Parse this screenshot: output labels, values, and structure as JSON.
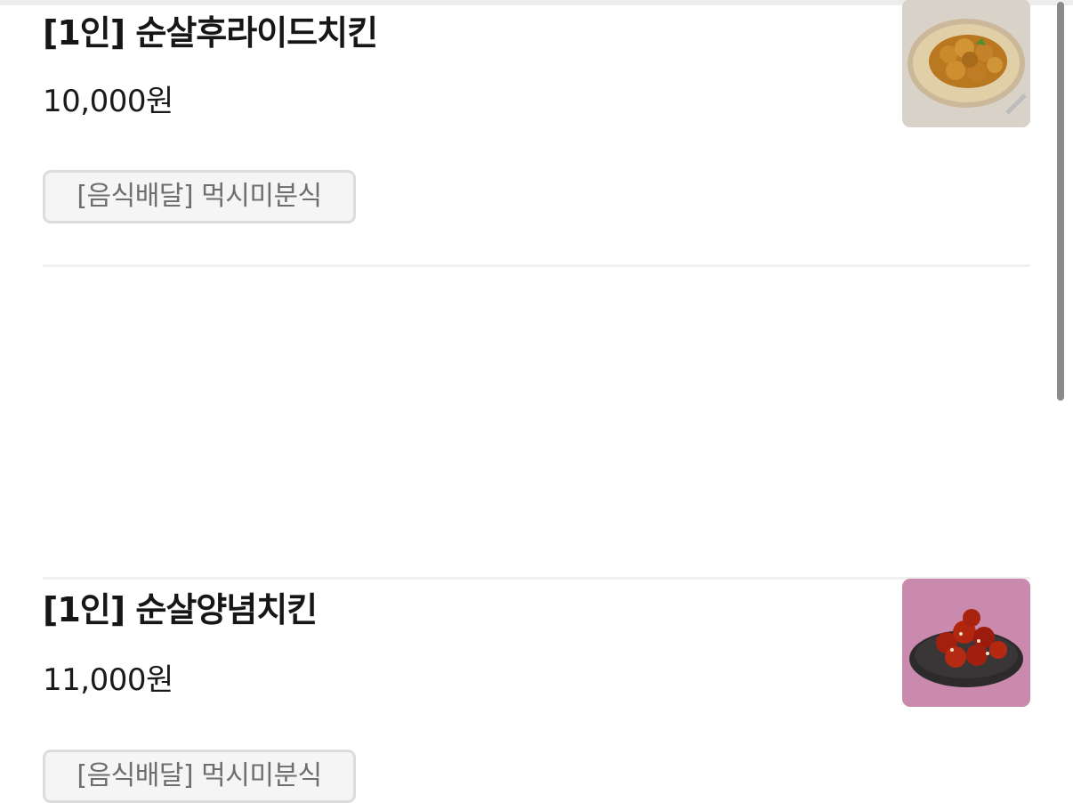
{
  "menu_items": [
    {
      "title": "[1인] 순살후라이드치킨",
      "price": "10,000원",
      "tag": "[음식배달] 먹시미분식",
      "image": "fried-chicken-photo"
    },
    {
      "title": "[1인] 순살양념치킨",
      "price": "11,000원",
      "tag": "[음식배달] 먹시미분식",
      "image": "seasoned-chicken-photo"
    }
  ],
  "colors": {
    "divider": "#f0f0f0",
    "tag_border": "#dcdcdc",
    "tag_text": "#6e6e6e",
    "scrollbar": "#8a8a8a"
  }
}
